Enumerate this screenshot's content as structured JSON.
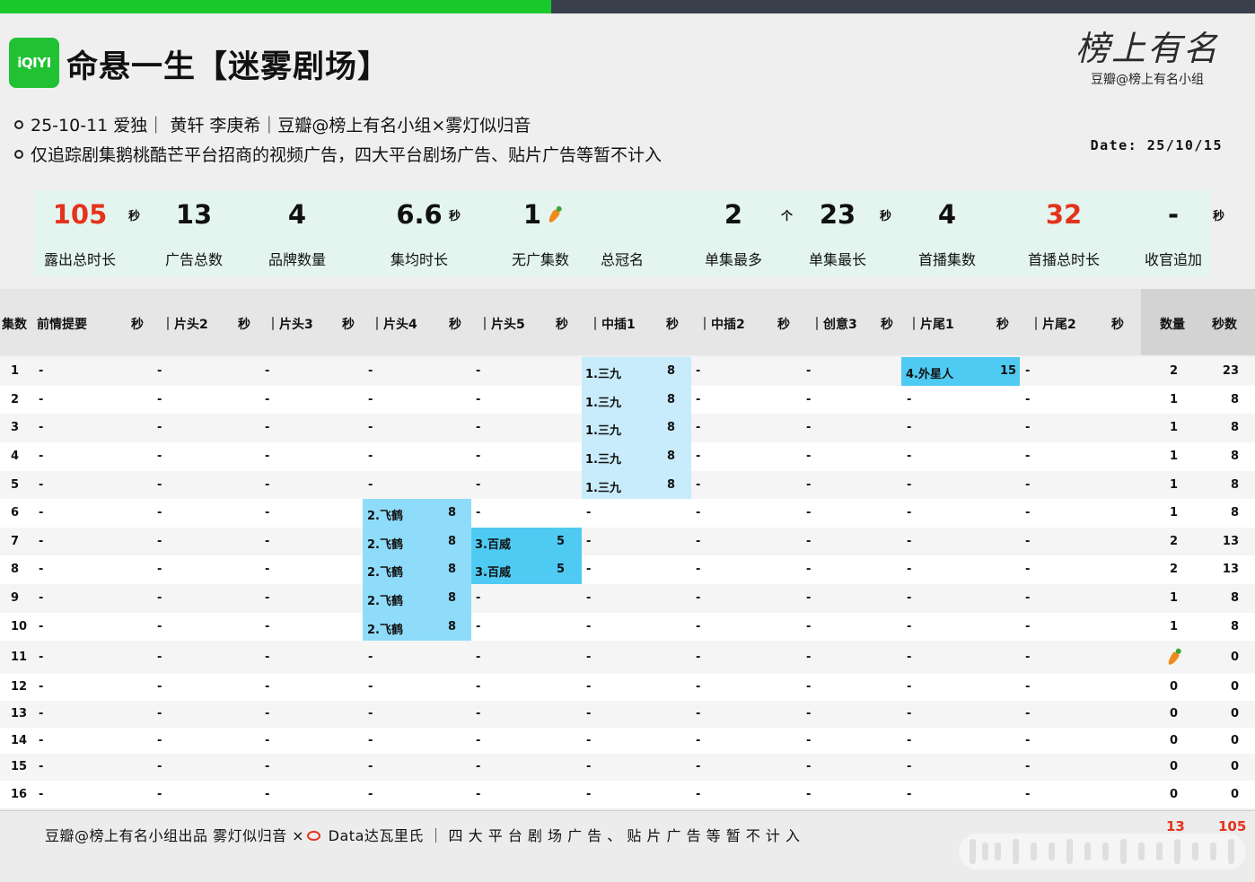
{
  "header": {
    "logo_text": "iQIYI",
    "title": "命悬一生【迷雾剧场】",
    "brand_script": "榜上有名",
    "brand_sub": "豆瓣@榜上有名小组",
    "info_line1": "25-10-11 爱独｜ 黄轩 李庚希｜豆瓣@榜上有名小组×雾灯似归音",
    "info_line2": "仅追踪剧集鹅桃酷芒平台招商的视频广告，四大平台剧场广告、贴片广告等暂不计入",
    "date": "Date: 25/10/15"
  },
  "stats": [
    {
      "value": "105",
      "unit": "秒",
      "label": "露出总时长",
      "red": true
    },
    {
      "value": "13",
      "unit": "",
      "label": "广告总数",
      "red": false
    },
    {
      "value": "4",
      "unit": "",
      "label": "品牌数量",
      "red": false
    },
    {
      "value": "6.6",
      "unit": "秒",
      "label": "集均时长",
      "red": false
    },
    {
      "value": "1",
      "unit": "",
      "label": "无广集数",
      "red": false,
      "carrot": true
    },
    {
      "value": "",
      "unit": "",
      "label": "总冠名",
      "red": false
    },
    {
      "value": "2",
      "unit": "个",
      "label": "单集最多",
      "red": false
    },
    {
      "value": "23",
      "unit": "秒",
      "label": "单集最长",
      "red": false
    },
    {
      "value": "4",
      "unit": "",
      "label": "首播集数",
      "red": false
    },
    {
      "value": "32",
      "unit": "",
      "label": "首播总时长",
      "red": true
    },
    {
      "value": "-",
      "unit": "秒",
      "label": "收官追加",
      "red": false
    }
  ],
  "table": {
    "headers": [
      "集数",
      "前情提要",
      "秒",
      "｜片头2",
      "秒",
      "｜片头3",
      "秒",
      "｜片头4",
      "秒",
      "｜片头5",
      "秒",
      "｜中插1",
      "秒",
      "｜中插2",
      "秒",
      "｜创意3",
      "秒",
      "｜片尾1",
      "秒",
      "｜片尾2",
      "秒",
      "数量",
      "秒数"
    ],
    "rows": [
      {
        "ep": "1",
        "c": [
          "-",
          "-",
          "-",
          "-",
          "-",
          "1.三九",
          "-",
          "-",
          "4.外星人",
          "-"
        ],
        "s": [
          "",
          "",
          "",
          "",
          "",
          "8",
          "",
          "",
          "15",
          ""
        ],
        "count": "2",
        "secs": "23"
      },
      {
        "ep": "2",
        "c": [
          "-",
          "-",
          "-",
          "-",
          "-",
          "1.三九",
          "-",
          "-",
          "-",
          "-"
        ],
        "s": [
          "",
          "",
          "",
          "",
          "",
          "8",
          "",
          "",
          "",
          ""
        ],
        "count": "1",
        "secs": "8"
      },
      {
        "ep": "3",
        "c": [
          "-",
          "-",
          "-",
          "-",
          "-",
          "1.三九",
          "-",
          "-",
          "-",
          "-"
        ],
        "s": [
          "",
          "",
          "",
          "",
          "",
          "8",
          "",
          "",
          "",
          ""
        ],
        "count": "1",
        "secs": "8"
      },
      {
        "ep": "4",
        "c": [
          "-",
          "-",
          "-",
          "-",
          "-",
          "1.三九",
          "-",
          "-",
          "-",
          "-"
        ],
        "s": [
          "",
          "",
          "",
          "",
          "",
          "8",
          "",
          "",
          "",
          ""
        ],
        "count": "1",
        "secs": "8"
      },
      {
        "ep": "5",
        "c": [
          "-",
          "-",
          "-",
          "-",
          "-",
          "1.三九",
          "-",
          "-",
          "-",
          "-"
        ],
        "s": [
          "",
          "",
          "",
          "",
          "",
          "8",
          "",
          "",
          "",
          ""
        ],
        "count": "1",
        "secs": "8"
      },
      {
        "ep": "6",
        "c": [
          "-",
          "-",
          "-",
          "2.飞鹤",
          "-",
          "-",
          "-",
          "-",
          "-",
          "-"
        ],
        "s": [
          "",
          "",
          "",
          "8",
          "",
          "",
          "",
          "",
          "",
          ""
        ],
        "count": "1",
        "secs": "8"
      },
      {
        "ep": "7",
        "c": [
          "-",
          "-",
          "-",
          "2.飞鹤",
          "3.百威",
          "-",
          "-",
          "-",
          "-",
          "-"
        ],
        "s": [
          "",
          "",
          "",
          "8",
          "5",
          "",
          "",
          "",
          "",
          ""
        ],
        "count": "2",
        "secs": "13"
      },
      {
        "ep": "8",
        "c": [
          "-",
          "-",
          "-",
          "2.飞鹤",
          "3.百威",
          "-",
          "-",
          "-",
          "-",
          "-"
        ],
        "s": [
          "",
          "",
          "",
          "8",
          "5",
          "",
          "",
          "",
          "",
          ""
        ],
        "count": "2",
        "secs": "13"
      },
      {
        "ep": "9",
        "c": [
          "-",
          "-",
          "-",
          "2.飞鹤",
          "-",
          "-",
          "-",
          "-",
          "-",
          "-"
        ],
        "s": [
          "",
          "",
          "",
          "8",
          "",
          "",
          "",
          "",
          "",
          ""
        ],
        "count": "1",
        "secs": "8"
      },
      {
        "ep": "10",
        "c": [
          "-",
          "-",
          "-",
          "2.飞鹤",
          "-",
          "-",
          "-",
          "-",
          "-",
          "-"
        ],
        "s": [
          "",
          "",
          "",
          "8",
          "",
          "",
          "",
          "",
          "",
          ""
        ],
        "count": "1",
        "secs": "8"
      },
      {
        "ep": "11",
        "c": [
          "-",
          "-",
          "-",
          "-",
          "-",
          "-",
          "-",
          "-",
          "-",
          "-"
        ],
        "s": [
          "",
          "",
          "",
          "",
          "",
          "",
          "",
          "",
          "",
          ""
        ],
        "count": "",
        "secs": "0",
        "carrot": true
      },
      {
        "ep": "12",
        "c": [
          "-",
          "-",
          "-",
          "-",
          "-",
          "-",
          "-",
          "-",
          "-",
          "-"
        ],
        "s": [
          "",
          "",
          "",
          "",
          "",
          "",
          "",
          "",
          "",
          ""
        ],
        "count": "0",
        "secs": "0"
      },
      {
        "ep": "13",
        "c": [
          "-",
          "-",
          "-",
          "-",
          "-",
          "-",
          "-",
          "-",
          "-",
          "-"
        ],
        "s": [
          "",
          "",
          "",
          "",
          "",
          "",
          "",
          "",
          "",
          ""
        ],
        "count": "0",
        "secs": "0"
      },
      {
        "ep": "14",
        "c": [
          "-",
          "-",
          "-",
          "-",
          "-",
          "-",
          "-",
          "-",
          "-",
          "-"
        ],
        "s": [
          "",
          "",
          "",
          "",
          "",
          "",
          "",
          "",
          "",
          ""
        ],
        "count": "0",
        "secs": "0"
      },
      {
        "ep": "15",
        "c": [
          "-",
          "-",
          "-",
          "-",
          "-",
          "-",
          "-",
          "-",
          "-",
          "-"
        ],
        "s": [
          "",
          "",
          "",
          "",
          "",
          "",
          "",
          "",
          "",
          ""
        ],
        "count": "0",
        "secs": "0"
      },
      {
        "ep": "16",
        "c": [
          "-",
          "-",
          "-",
          "-",
          "-",
          "-",
          "-",
          "-",
          "-",
          "-"
        ],
        "s": [
          "",
          "",
          "",
          "",
          "",
          "",
          "",
          "",
          "",
          ""
        ],
        "count": "0",
        "secs": "0"
      }
    ]
  },
  "footer": {
    "credit_a": "豆瓣@榜上有名小组出品  雾灯似归音 ×",
    "credit_b": " Data达瓦里氏 ｜ 四 大 平 台 剧 场 广 告 、 贴 片 广 告 等 暂 不 计 入",
    "total_count": "13",
    "total_secs": "105"
  },
  "colors": {
    "green": "#19c92c",
    "dark_bar": "#3a3f4c",
    "accent_red": "#e4331c",
    "ad_light_blue": "#c8ecfb",
    "ad_mid_blue": "#8fdcfa",
    "ad_dark_blue": "#4fcbf3",
    "stats_bg": "#e3f5ee"
  },
  "icons": [
    "iqiyi-logo-icon",
    "carrot-icon",
    "weibo-icon"
  ]
}
